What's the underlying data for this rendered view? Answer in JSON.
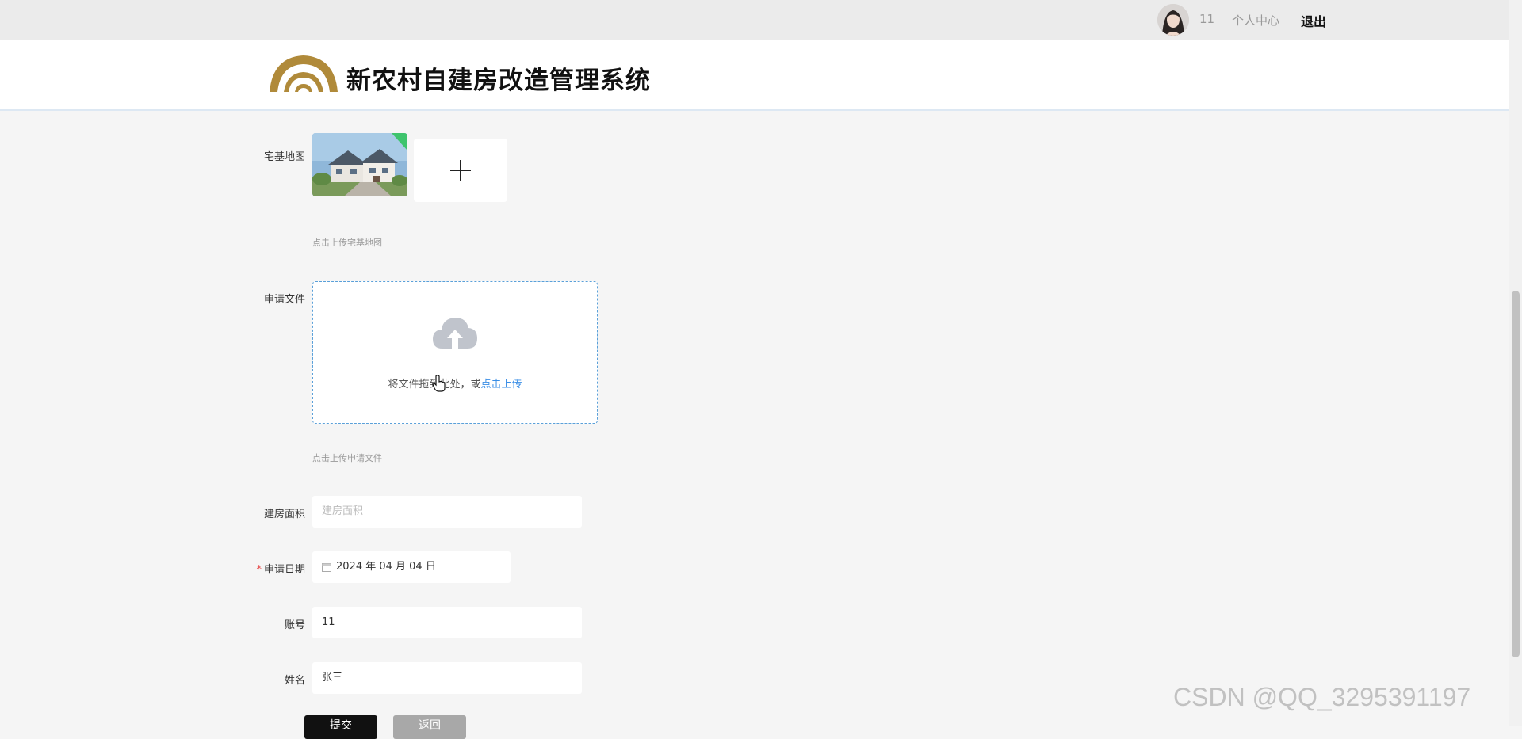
{
  "topbar": {
    "username": "11",
    "profile_link": "个人中心",
    "logout": "退出"
  },
  "header": {
    "site_title": "新农村自建房改造管理系统",
    "logo_color": "#b08a3a"
  },
  "form": {
    "homestead_label": "宅基地图",
    "homestead_hint": "点击上传宅基地图",
    "apply_file_label": "申请文件",
    "dropzone_text": "将文件拖到此处，或",
    "dropzone_link": "点击上传",
    "apply_file_hint": "点击上传申请文件",
    "area_label": "建房面积",
    "area_placeholder": "建房面积",
    "date_label": "申请日期",
    "date_value": "2024 年 04 月 04 日",
    "account_label": "账号",
    "account_value": "11",
    "name_label": "姓名",
    "name_value": "张三",
    "required_mark": "*"
  },
  "buttons": {
    "submit": "提交",
    "back": "返回"
  },
  "watermark": "CSDN @QQ_3295391197",
  "colors": {
    "accent_link": "#3a8ee6",
    "required": "#e64242",
    "submit_bg": "#111111",
    "back_bg": "#a8a8a8"
  }
}
